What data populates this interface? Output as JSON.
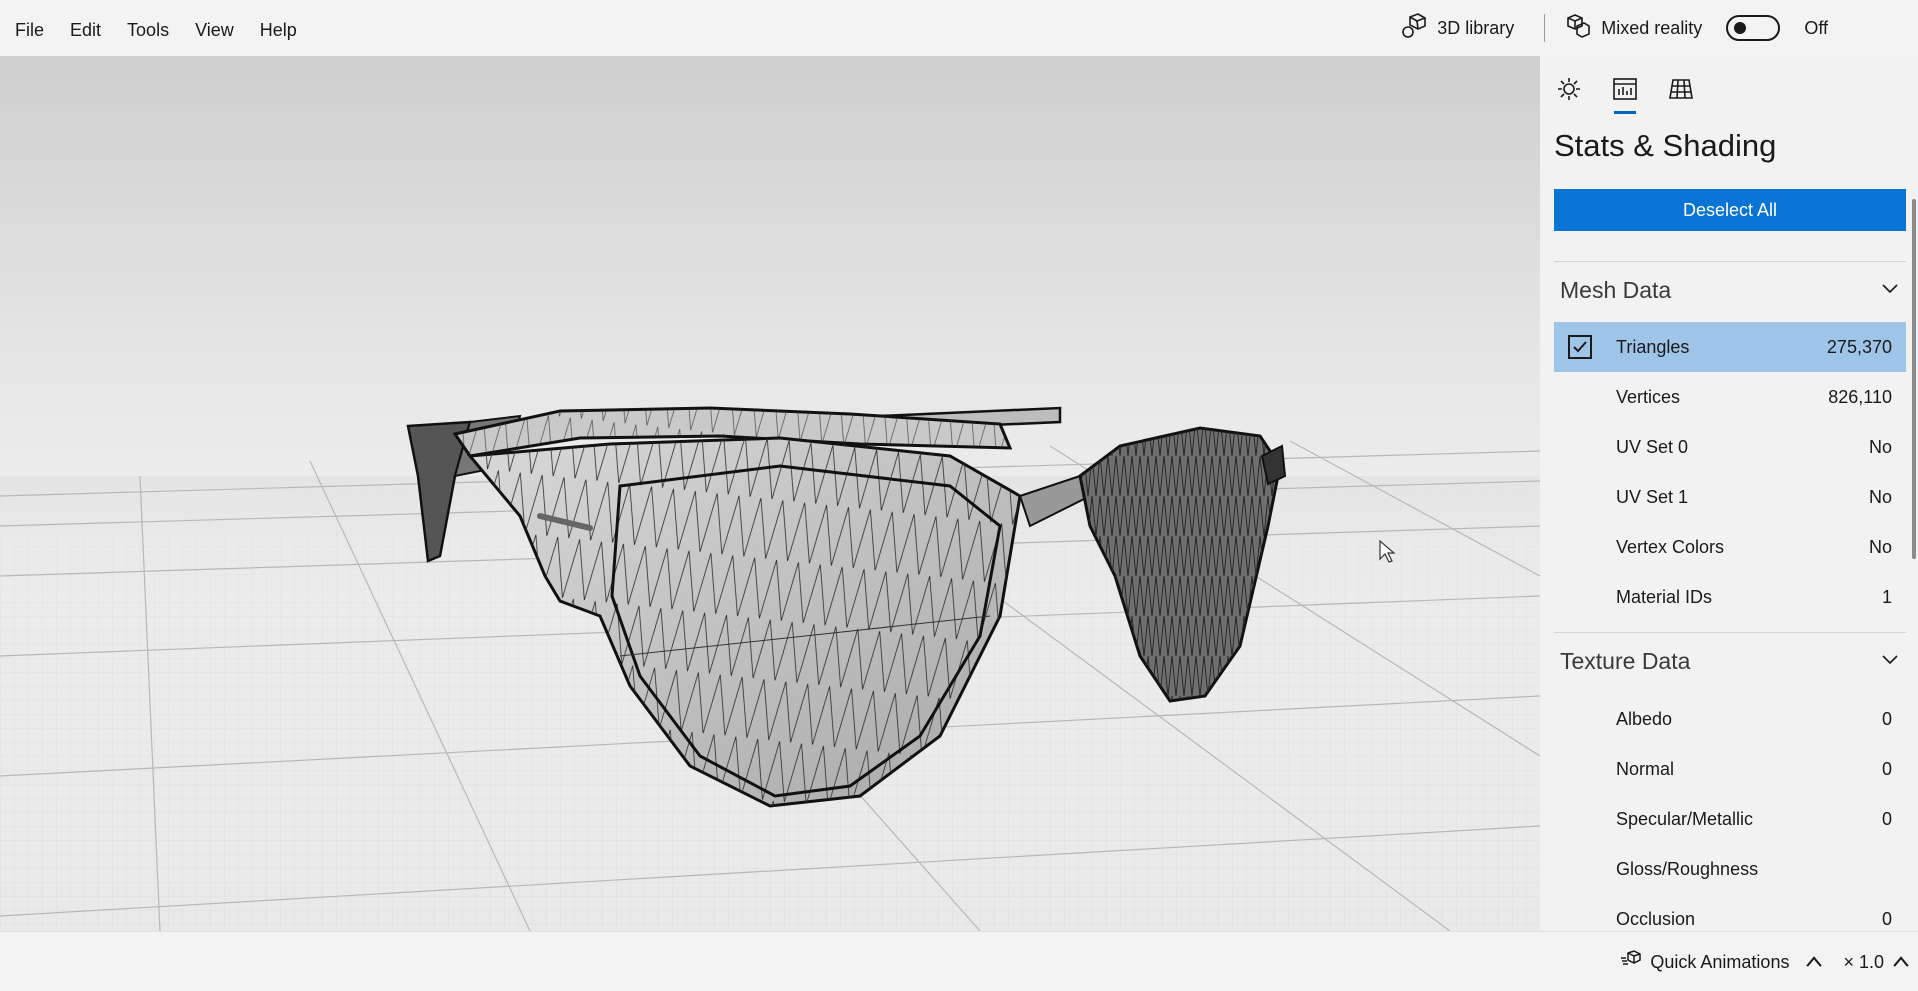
{
  "menu": [
    "File",
    "Edit",
    "Tools",
    "View",
    "Help"
  ],
  "toolbar": {
    "library_label": "3D library",
    "mixed_reality_label": "Mixed reality",
    "mixed_reality_state": "Off"
  },
  "panel": {
    "title": "Stats & Shading",
    "deselect_label": "Deselect All",
    "mesh": {
      "title": "Mesh Data",
      "rows": [
        {
          "label": "Triangles",
          "value": "275,370"
        },
        {
          "label": "Vertices",
          "value": "826,110"
        },
        {
          "label": "UV Set 0",
          "value": "No"
        },
        {
          "label": "UV Set 1",
          "value": "No"
        },
        {
          "label": "Vertex Colors",
          "value": "No"
        },
        {
          "label": "Material IDs",
          "value": "1"
        }
      ]
    },
    "texture": {
      "title": "Texture Data",
      "rows": [
        {
          "label": "Albedo",
          "value": "0"
        },
        {
          "label": "Normal",
          "value": "0"
        },
        {
          "label": "Specular/Metallic",
          "value": "0"
        },
        {
          "label": "Gloss/Roughness",
          "value": ""
        },
        {
          "label": "Occlusion",
          "value": "0"
        }
      ]
    }
  },
  "status": {
    "quick_animations": "Quick Animations",
    "speed": "× 1.0"
  },
  "colors": {
    "accent": "#0a74d4",
    "selected_row": "#9ec5e8"
  }
}
